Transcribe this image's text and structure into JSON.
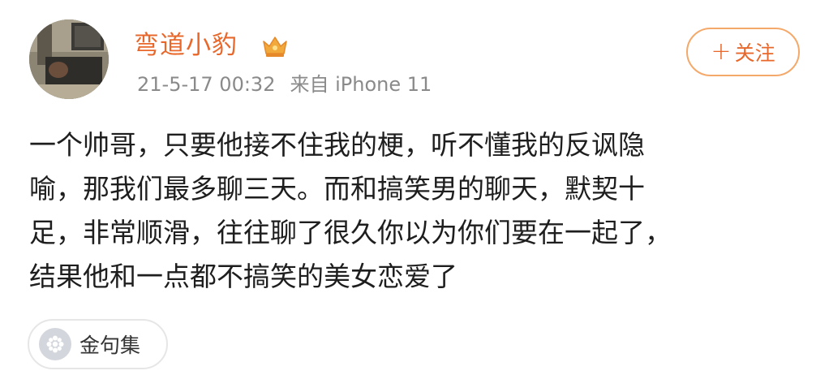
{
  "post": {
    "author": {
      "name": "弯道小豹",
      "badge_icon": "crown-vip-icon"
    },
    "meta": {
      "date": "21-5-17 00:32",
      "source": "来自 iPhone 11"
    },
    "follow_button": {
      "icon": "plus-icon",
      "plus": "+",
      "label": "关注"
    },
    "body_lines": [
      "一个帅哥，只要他接不住我的梗，听不懂我的反讽隐",
      "喻，那我们最多聊三天。而和搞笑男的聊天，默契十",
      "足，非常顺滑，往往聊了很久你以为你们要在一起了，",
      "结果他和一点都不搞笑的美女恋爱了"
    ],
    "topic_chip": {
      "icon": "flower-icon",
      "label": "金句集"
    }
  },
  "colors": {
    "accent": "#e8682b",
    "follow_border": "#f4a96a",
    "meta_text": "#8a8a8a",
    "body_text": "#1e1e1e",
    "chip_icon_bg": "#d3d6dc"
  }
}
